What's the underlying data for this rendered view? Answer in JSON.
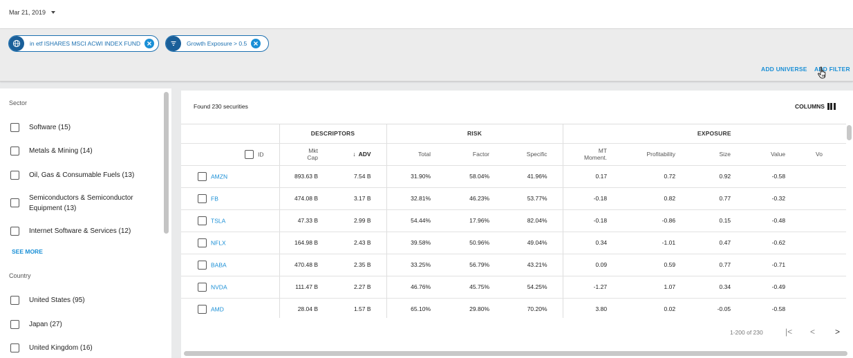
{
  "date_selector": {
    "value": "Mar 21, 2019"
  },
  "filters": [
    {
      "icon": "globe-icon",
      "label": "in etf ISHARES MSCI ACWI INDEX FUND"
    },
    {
      "icon": "filter-icon",
      "label": "Growth Exposure > 0.5"
    }
  ],
  "actions": {
    "add_universe": "ADD UNIVERSE",
    "add_filter": "ADD FILTER"
  },
  "sidebar": {
    "sector_title": "Sector",
    "sectors": [
      "Software (15)",
      "Metals & Mining (14)",
      "Oil, Gas & Consumable Fuels (13)",
      "Semiconductors & Semiconductor Equipment (13)",
      "Internet Software & Services (12)"
    ],
    "see_more": "SEE MORE",
    "country_title": "Country",
    "countries": [
      "United States (95)",
      "Japan (27)",
      "United Kingdom (16)"
    ]
  },
  "results": {
    "found": "Found 230 securities",
    "columns_label": "COLUMNS"
  },
  "table": {
    "groups": {
      "descriptors": "DESCRIPTORS",
      "risk": "RISK",
      "exposure": "EXPOSURE"
    },
    "headers": {
      "id": "ID",
      "mkt_cap_1": "Mkt",
      "mkt_cap_2": "Cap",
      "adv": "ADV",
      "total": "Total",
      "factor": "Factor",
      "specific": "Specific",
      "mt_1": "MT",
      "mt_2": "Moment.",
      "profitability": "Profitability",
      "size": "Size",
      "value": "Value",
      "vo": "Vo"
    },
    "rows": [
      {
        "id": "AMZN",
        "mkt_cap": "893.63 B",
        "adv": "7.54 B",
        "total": "31.90%",
        "factor": "58.04%",
        "specific": "41.96%",
        "mt": "0.17",
        "profitability": "0.72",
        "size": "0.92",
        "value": "-0.58"
      },
      {
        "id": "FB",
        "mkt_cap": "474.08 B",
        "adv": "3.17 B",
        "total": "32.81%",
        "factor": "46.23%",
        "specific": "53.77%",
        "mt": "-0.18",
        "profitability": "0.82",
        "size": "0.77",
        "value": "-0.32"
      },
      {
        "id": "TSLA",
        "mkt_cap": "47.33 B",
        "adv": "2.99 B",
        "total": "54.44%",
        "factor": "17.96%",
        "specific": "82.04%",
        "mt": "-0.18",
        "profitability": "-0.86",
        "size": "0.15",
        "value": "-0.48"
      },
      {
        "id": "NFLX",
        "mkt_cap": "164.98 B",
        "adv": "2.43 B",
        "total": "39.58%",
        "factor": "50.96%",
        "specific": "49.04%",
        "mt": "0.34",
        "profitability": "-1.01",
        "size": "0.47",
        "value": "-0.62"
      },
      {
        "id": "BABA",
        "mkt_cap": "470.48 B",
        "adv": "2.35 B",
        "total": "33.25%",
        "factor": "56.79%",
        "specific": "43.21%",
        "mt": "0.09",
        "profitability": "0.59",
        "size": "0.77",
        "value": "-0.71"
      },
      {
        "id": "NVDA",
        "mkt_cap": "111.47 B",
        "adv": "2.27 B",
        "total": "46.76%",
        "factor": "45.75%",
        "specific": "54.25%",
        "mt": "-1.27",
        "profitability": "1.07",
        "size": "0.34",
        "value": "-0.49"
      },
      {
        "id": "AMD",
        "mkt_cap": "28.04 B",
        "adv": "1.57 B",
        "total": "65.10%",
        "factor": "29.80%",
        "specific": "70.20%",
        "mt": "3.80",
        "profitability": "0.02",
        "size": "-0.05",
        "value": "-0.58"
      }
    ]
  },
  "pagination": {
    "range": "1-200 of 230"
  },
  "colors": {
    "accent": "#1a8fd6",
    "chip_icon": "#1a5f99",
    "background": "#e9eaeb"
  }
}
